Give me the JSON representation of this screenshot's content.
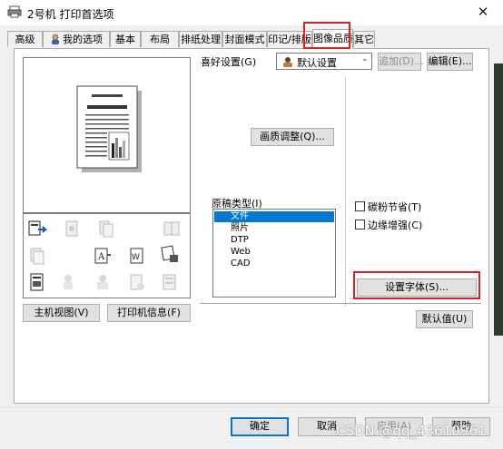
{
  "window": {
    "title": "2号机 打印首选项",
    "close_glyph": "✕"
  },
  "tabs": [
    {
      "label": "高级"
    },
    {
      "label": "我的选项"
    },
    {
      "label": "基本"
    },
    {
      "label": "布局"
    },
    {
      "label": "排纸处理"
    },
    {
      "label": "封面模式"
    },
    {
      "label": "印记/排版"
    },
    {
      "label": "图像品质",
      "active": true
    },
    {
      "label": "其它"
    }
  ],
  "left": {
    "main_view_button": "主机视图(V)",
    "printer_info_button": "打印机信息(F)"
  },
  "favorites": {
    "label": "喜好设置(G)",
    "selected": "默认设置",
    "add_button": "追加(D)...",
    "edit_button": "编辑(E)..."
  },
  "image": {
    "quality_adjust_button": "画质调整(Q)...",
    "original_type_label": "原稿类型(I)",
    "original_types": [
      {
        "label": "文件",
        "selected": true
      },
      {
        "label": "照片"
      },
      {
        "label": "DTP"
      },
      {
        "label": "Web"
      },
      {
        "label": "CAD"
      }
    ],
    "toner_save_label": "碳粉节省(T)",
    "toner_save_checked": false,
    "edge_enhance_label": "边缘增强(C)",
    "edge_enhance_checked": false,
    "font_settings_button": "设置字体(S)...",
    "default_button": "默认值(U)"
  },
  "footer": {
    "ok": "确定",
    "cancel": "取消",
    "apply": "应用(A)",
    "help": "帮助"
  },
  "watermark": "CSDN @qq_43610961",
  "colors": {
    "highlight": "#e81c1c",
    "selection": "#0078d7"
  },
  "icons": {
    "title": "printer-icon",
    "my_options_tab": "user-icon",
    "favorites": "favorites-icon"
  }
}
